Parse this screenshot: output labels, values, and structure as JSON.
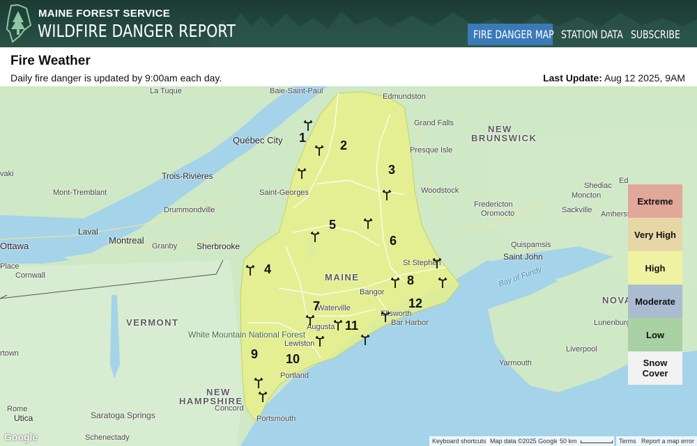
{
  "header": {
    "org": "MAINE FOREST SERVICE",
    "report": "WILDFIRE DANGER REPORT",
    "nav": [
      {
        "label": "FIRE DANGER MAP",
        "active": true
      },
      {
        "label": "STATION DATA",
        "active": false
      },
      {
        "label": "SUBSCRIBE",
        "active": false
      }
    ]
  },
  "page": {
    "title": "Fire Weather",
    "subtitle": "Daily fire danger is updated by 9:00am each day.",
    "update_label": "Last Update:",
    "update_value": "Aug 12 2025, 9AM"
  },
  "legend": [
    {
      "label": "Extreme",
      "color": "#e0a79a"
    },
    {
      "label": "Very High",
      "color": "#e7d7a6"
    },
    {
      "label": "High",
      "color": "#eef2a2"
    },
    {
      "label": "Moderate",
      "color": "#a9bcd0"
    },
    {
      "label": "Low",
      "color": "#a8d2a3"
    },
    {
      "label": "Snow Cover",
      "color": "#f2f2f2"
    }
  ],
  "zones": [
    "1",
    "2",
    "3",
    "4",
    "5",
    "6",
    "7",
    "8",
    "9",
    "10",
    "11",
    "12"
  ],
  "places": {
    "la_tuque": "La Tuque",
    "baie_saint_paul": "Baie-Saint-Paul",
    "edmundston": "Edmundston",
    "grand_falls": "Grand Falls",
    "new_brunswick_1": "NEW",
    "new_brunswick_2": "BRUNSWICK",
    "quebec_city": "Québec City",
    "presque_isle": "Presque Isle",
    "trois_rivieres": "Trois-Rivières",
    "mont_tremblant": "Mont-Tremblant",
    "saint_georges": "Saint-Georges",
    "woodstock": "Woodstock",
    "shediac": "Shediac",
    "moncton": "Moncton",
    "drummondville": "Drummondville",
    "fredericton": "Fredericton",
    "oromocto": "Oromocto",
    "sackville": "Sackville",
    "amherst": "Amherst",
    "laval": "Laval",
    "montreal": "Montreal",
    "granby": "Granby",
    "sherbrooke": "Sherbrooke",
    "ottawa": "Ottawa",
    "quispamsis": "Quispamsis",
    "saint_john": "Saint John",
    "st_stephen": "St Stephen",
    "maine": "MAINE",
    "bangor": "Bangor",
    "bay_of_fundy": "Bay of Fundy",
    "cornwall": "Cornwall",
    "place": "Place",
    "vermont": "VERMONT",
    "waterville": "Waterville",
    "augusta": "Augusta",
    "ellsworth": "Ellsworth",
    "bar_harbor": "Bar Harbor",
    "nova_scotia": "NOVA SCOTIA",
    "lunenburg": "Lunenburg",
    "white_mountain": "White Mountain National Forest",
    "lewiston": "Lewiston",
    "portland": "Portland",
    "liverpool": "Liverpool",
    "yarmouth": "Yarmouth",
    "new_hampshire_1": "NEW",
    "new_hampshire_2": "HAMPSHIRE",
    "concord": "Concord",
    "rome": "Rome",
    "utica": "Utica",
    "saratoga": "Saratoga Springs",
    "portsmouth": "Portsmouth",
    "schenectady": "Schenectady",
    "rtown": "rtown",
    "vaki": "vaki",
    "ed": "Ed"
  },
  "attribution": {
    "keyboard": "Keyboard shortcuts",
    "mapdata": "Map data ©2025 Google",
    "scale": "50 km",
    "terms": "Terms",
    "report": "Report a map error",
    "google": "Google"
  },
  "colors": {
    "header_bg": "#22473c",
    "nav_active": "#3b7ab8",
    "maine_fill": "#e8f08a",
    "water": "#a4d3ea",
    "land": "#cfe8c6"
  }
}
